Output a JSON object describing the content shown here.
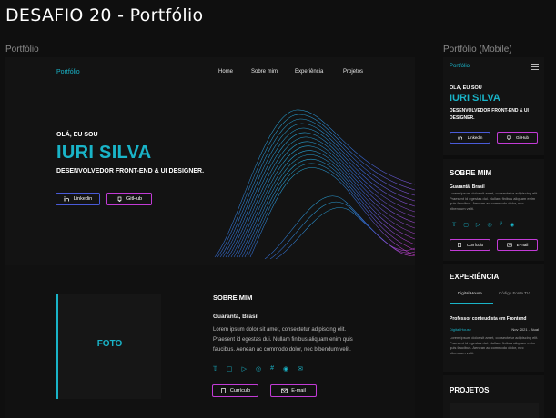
{
  "page": {
    "title": "DESAFIO 20 - Portfólio"
  },
  "labels": {
    "desktop": "Portfólio",
    "mobile": "Portfólio (Mobile)"
  },
  "desktop": {
    "nav": {
      "logo": "Portfólio",
      "links": [
        "Home",
        "Sobre mim",
        "Experiência",
        "Projetos"
      ]
    },
    "hero": {
      "hello": "OLÁ, EU SOU",
      "name": "IURI SILVA",
      "role": "DESENVOLVEDOR FRONT-END & UI DESIGNER.",
      "buttons": {
        "linkedin": "Linkedin",
        "github": "GitHub"
      }
    },
    "about": {
      "photo_label": "FOTO",
      "title": "SOBRE MIM",
      "location": "Guarantã, Brasil",
      "text": "Lorem ipsum dolor sit amet, consectetur adipiscing elit. Praesent id egestas dui. Nullam finibus aliquam enim quis faucibus. Aenean ac commodo dolor, nec bibendum velit.",
      "buttons": {
        "resume": "Currículo",
        "email": "E-mail"
      }
    }
  },
  "mobile": {
    "nav": {
      "logo": "Portfólio"
    },
    "hero": {
      "hello": "OLÁ, EU SOU",
      "name": "IURI SILVA",
      "role": "DESENVOLVEDOR FRONT-END & UI DESIGNER.",
      "buttons": {
        "linkedin": "Linkedin",
        "github": "GitHub"
      }
    },
    "about": {
      "title": "SOBRE MIM",
      "location": "Guarantã, Brasil",
      "text": "Lorem ipsum dolor sit amet, consectetur adipiscing elit. Praesent id egestas dui. Nullam finibus aliquam enim quis faucibus. Aenean ac commodo dolor, nec bibendum velit.",
      "buttons": {
        "resume": "Currículo",
        "email": "E-mail"
      }
    },
    "experience": {
      "title": "EXPERIÊNCIA",
      "tabs": [
        "Digital House",
        "Código Fonte TV"
      ],
      "job": "Professor conteudista em Frontend",
      "company": "Digital House",
      "date": "Nov 2021 - Atual",
      "text": "Lorem ipsum dolor sit amet, consectetur adipiscing elit. Praesent id egestas dui. Nullam finibus aliquam enim quis faucibus. Aenean ac commodo dolor, nec bibendum velit."
    },
    "projects": {
      "title": "PROJETOS"
    }
  },
  "colors": {
    "accent": "#19b4c8",
    "btn_blue": "#4a5bd9",
    "btn_pink": "#c23bd6",
    "background": "#0f0f0f",
    "frame": "#131313"
  },
  "icons": [
    "linkedin-icon",
    "github-icon",
    "twitter-icon",
    "twitch-icon",
    "youtube-icon",
    "discord-icon",
    "dribbble-icon",
    "globe-icon",
    "document-icon",
    "mail-icon",
    "menu-icon"
  ]
}
